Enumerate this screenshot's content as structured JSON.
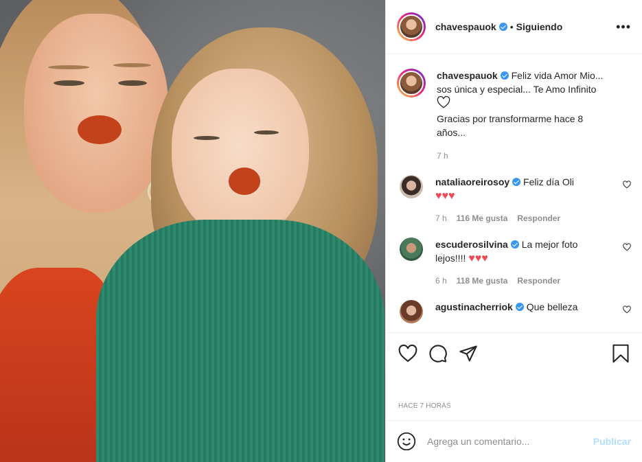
{
  "post": {
    "author": "chavespauok",
    "follow_status": "Siguiendo",
    "more_icon": "more-horizontal-icon",
    "caption_lines": [
      "Feliz vida Amor Mio...",
      "sos única y especial... Te Amo Infinito",
      "Gracias por transformarme hace 8",
      "años..."
    ],
    "caption_time": "7 h"
  },
  "comments": [
    {
      "user": "nataliaoreirosoy",
      "text": "Feliz día Oli",
      "hearts": "♥♥♥",
      "time": "7 h",
      "likes": "116 Me gusta",
      "reply": "Responder"
    },
    {
      "user": "escuderosilvina",
      "text": "La mejor foto",
      "text2": "lejos!!!!",
      "hearts": "♥♥♥",
      "time": "6 h",
      "likes": "118 Me gusta",
      "reply": "Responder"
    },
    {
      "user": "agustinacherriok",
      "text": "Que belleza"
    }
  ],
  "footer": {
    "timestamp": "HACE 7 HORAS",
    "comment_placeholder": "Agrega un comentario...",
    "publish_label": "Publicar"
  },
  "colors": {
    "verified": "#3897f0",
    "heart": "#ed4956",
    "publish_disabled": "#b2dffc"
  }
}
